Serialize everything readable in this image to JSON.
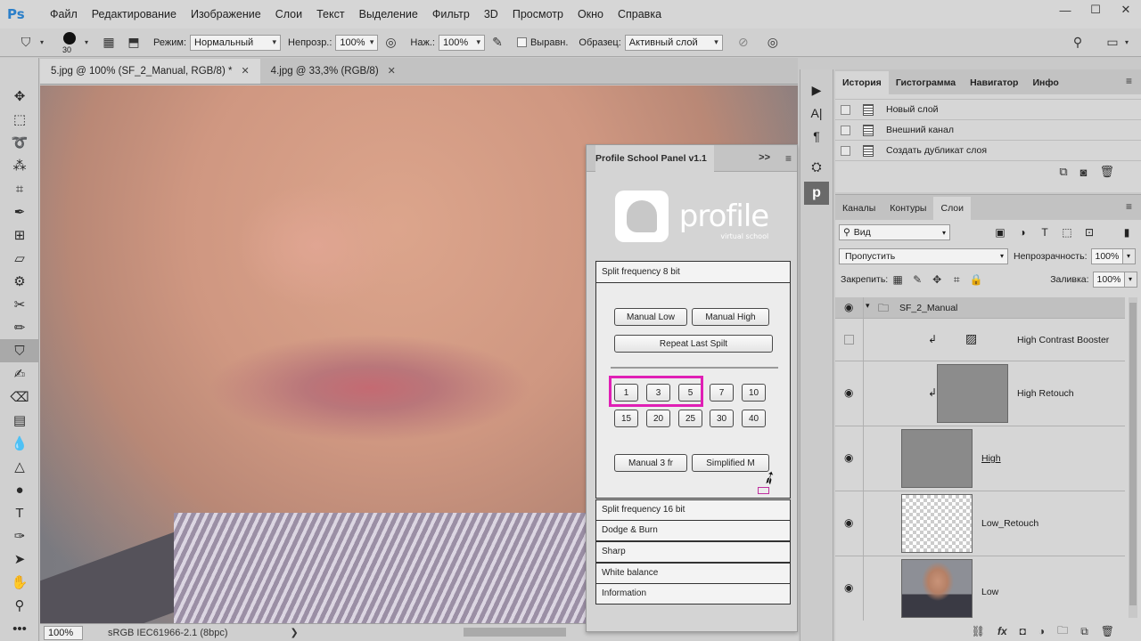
{
  "app": {
    "logo": "Ps"
  },
  "menu": [
    "Файл",
    "Редактирование",
    "Изображение",
    "Слои",
    "Текст",
    "Выделение",
    "Фильтр",
    "3D",
    "Просмотр",
    "Окно",
    "Справка"
  ],
  "options": {
    "brush_size": "30",
    "mode_label": "Режим:",
    "mode_value": "Нормальный",
    "opacity_label": "Непрозр.:",
    "opacity_value": "100%",
    "flow_label": "Наж.:",
    "flow_value": "100%",
    "aligned_label": "Выравн.",
    "sample_label": "Образец:",
    "sample_value": "Активный слой"
  },
  "tabs": [
    {
      "label": "5.jpg @ 100% (SF_2_Manual, RGB/8) *",
      "active": true
    },
    {
      "label": "4.jpg @ 33,3% (RGB/8)",
      "active": false
    }
  ],
  "status": {
    "zoom": "100%",
    "doc_info": "sRGB IEC61966-2.1 (8bpc)",
    "arrow": "❯"
  },
  "plugin_panel": {
    "title": "Profile School Panel v1.1",
    "logo_text": "profile",
    "logo_sub": "virtual school",
    "section_8bit": "Split frequency 8 bit",
    "btn_manual_low": "Manual Low",
    "btn_manual_high": "Manual High",
    "btn_repeat": "Repeat Last Spilt",
    "numbers_row1": [
      "1",
      "3",
      "5",
      "7",
      "10"
    ],
    "numbers_row2": [
      "15",
      "20",
      "25",
      "30",
      "40"
    ],
    "btn_manual3": "Manual 3 fr",
    "btn_simplified": "Simplified M",
    "sections": [
      "Split frequency 16 bit",
      "Dodge & Burn",
      "Sharp",
      "White balance",
      "Information"
    ]
  },
  "history_panel": {
    "tabs": [
      "История",
      "Гистограмма",
      "Навигатор",
      "Инфо"
    ],
    "items": [
      "Новый слой",
      "Внешний канал",
      "Создать дубликат слоя"
    ]
  },
  "layers_panel": {
    "tabs": [
      "Каналы",
      "Контуры",
      "Слои"
    ],
    "filter_label": "Вид",
    "blend_mode": "Пропустить",
    "opacity_label": "Непрозрачность:",
    "opacity_value": "100%",
    "lock_label": "Закрепить:",
    "fill_label": "Заливка:",
    "fill_value": "100%",
    "layers": [
      "SF_2_Manual",
      "High Contrast Booster",
      "High Retouch",
      "High ",
      "Low_Retouch",
      "Low"
    ]
  },
  "colors": {
    "highlight": "#e01fb5",
    "accent_blue": "#2b7fc9"
  }
}
